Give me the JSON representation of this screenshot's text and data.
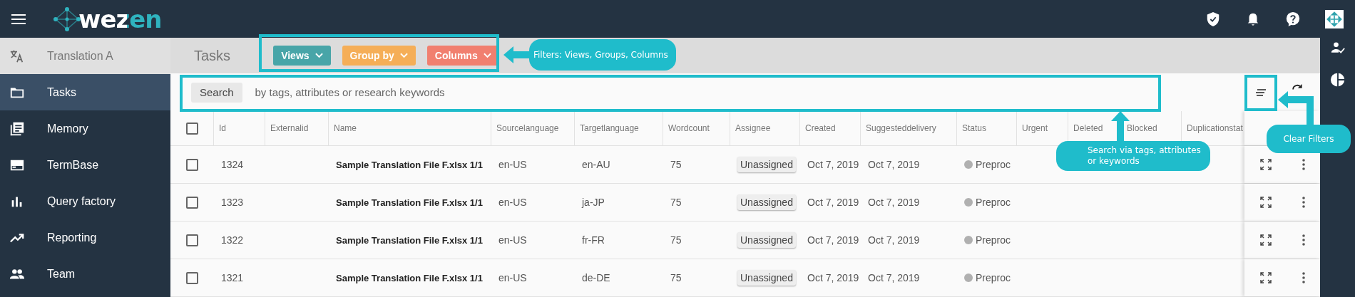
{
  "header": {
    "logo": "wezen"
  },
  "sidebar": {
    "items": [
      {
        "label": "Translation A",
        "kind": "project",
        "selected": false
      },
      {
        "label": "Tasks",
        "kind": "nav",
        "selected": true
      },
      {
        "label": "Memory",
        "kind": "nav",
        "selected": false
      },
      {
        "label": "TermBase",
        "kind": "nav",
        "selected": false
      },
      {
        "label": "Query factory",
        "kind": "nav",
        "selected": false
      },
      {
        "label": "Reporting",
        "kind": "nav",
        "selected": false
      },
      {
        "label": "Team",
        "kind": "nav",
        "selected": false
      }
    ]
  },
  "page_title": "Tasks",
  "filter_buttons": [
    {
      "label": "Views",
      "color": "#48a5a8"
    },
    {
      "label": "Group by",
      "color": "#f5ae57"
    },
    {
      "label": "Columns",
      "color": "#f17f6f"
    }
  ],
  "search": {
    "button": "Search",
    "placeholder": "by tags, attributes or research keywords"
  },
  "table": {
    "all_checked": false,
    "columns": [
      "Id",
      "Externalid",
      "Name",
      "Sourcelanguage",
      "Targetlanguage",
      "Wordcount",
      "Assignee",
      "Created",
      "Suggesteddelivery",
      "Status",
      "Urgent",
      "Deleted",
      "Blocked",
      "Duplicationstat"
    ],
    "rows": [
      {
        "checked": false,
        "id": "1324",
        "name": "Sample Translation File F.xlsx 1/1",
        "source": "en-US",
        "target": "en-AU",
        "wordcount": "75",
        "assignee": "Unassigned",
        "created": "Oct 7, 2019",
        "delivery": "Oct 7, 2019",
        "status": {
          "label": "Preproc",
          "color": "#b0b0b0"
        }
      },
      {
        "checked": false,
        "id": "1323",
        "name": "Sample Translation File F.xlsx 1/1",
        "source": "en-US",
        "target": "ja-JP",
        "wordcount": "75",
        "assignee": "Unassigned",
        "created": "Oct 7, 2019",
        "delivery": "Oct 7, 2019",
        "status": {
          "label": "Preproc",
          "color": "#b0b0b0"
        }
      },
      {
        "checked": false,
        "id": "1322",
        "name": "Sample Translation File F.xlsx 1/1",
        "source": "en-US",
        "target": "fr-FR",
        "wordcount": "75",
        "assignee": "Unassigned",
        "created": "Oct 7, 2019",
        "delivery": "Oct 7, 2019",
        "status": {
          "label": "Preproc",
          "color": "#b0b0b0"
        }
      },
      {
        "checked": false,
        "id": "1321",
        "name": "Sample Translation File F.xlsx 1/1",
        "source": "en-US",
        "target": "de-DE",
        "wordcount": "75",
        "assignee": "Unassigned",
        "created": "Oct 7, 2019",
        "delivery": "Oct 7, 2019",
        "status": {
          "label": "Preproc",
          "color": "#b0b0b0"
        }
      }
    ]
  },
  "annotations": [
    {
      "kind": "filters",
      "text": "Filters: Views, Groups, Columns"
    },
    {
      "kind": "search",
      "text": "Search via tags, attributes or keywords"
    },
    {
      "kind": "clear",
      "text": "Clear Filters"
    }
  ]
}
